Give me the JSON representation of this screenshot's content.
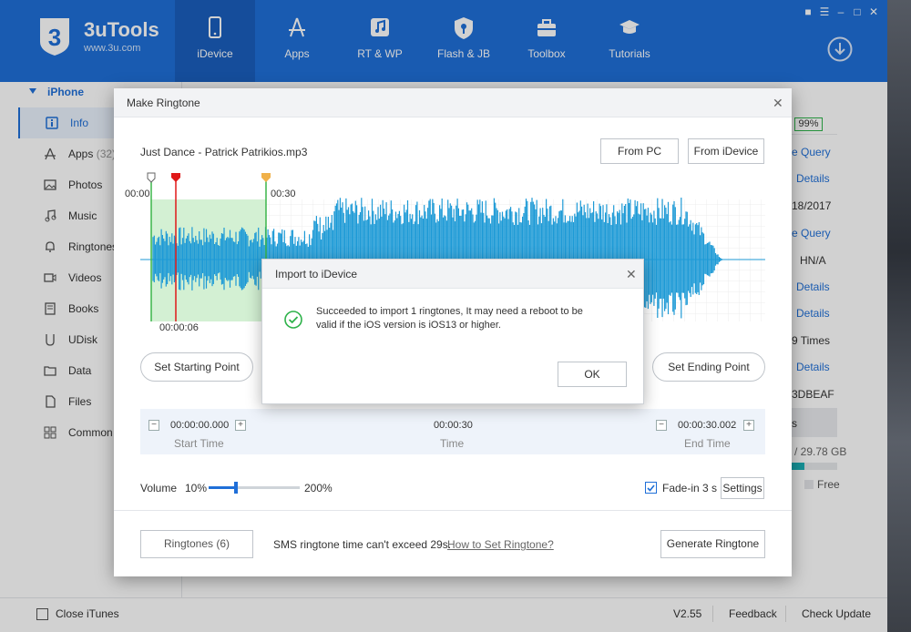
{
  "app": {
    "brand": "3uTools",
    "url": "www.3u.com",
    "nav": [
      {
        "label": "iDevice",
        "icon": "phone-icon",
        "active": true
      },
      {
        "label": "Apps",
        "icon": "appstore-icon"
      },
      {
        "label": "RT & WP",
        "icon": "music-note-icon"
      },
      {
        "label": "Flash & JB",
        "icon": "shield-key-icon"
      },
      {
        "label": "Toolbox",
        "icon": "toolbox-icon"
      },
      {
        "label": "Tutorials",
        "icon": "graduation-cap-icon"
      }
    ]
  },
  "sidebar": {
    "header": "iPhone",
    "items": [
      {
        "label": "Info",
        "icon": "info-icon"
      },
      {
        "label": "Apps",
        "count": "(32)",
        "icon": "appstore-icon"
      },
      {
        "label": "Photos",
        "icon": "photo-icon"
      },
      {
        "label": "Music",
        "icon": "music-icon"
      },
      {
        "label": "Ringtones",
        "icon": "bell-icon"
      },
      {
        "label": "Videos",
        "icon": "video-icon"
      },
      {
        "label": "Books",
        "icon": "book-icon"
      },
      {
        "label": "UDisk",
        "icon": "udisk-icon"
      },
      {
        "label": "Data",
        "icon": "folder-icon"
      },
      {
        "label": "Files",
        "icon": "file-icon"
      },
      {
        "label": "Common",
        "icon": "grid-icon"
      }
    ]
  },
  "info_panel": {
    "battery": "99%",
    "row1": "e Query",
    "row2": "Details",
    "row3": "18/2017",
    "row4": "e Query",
    "row5": "HN/A",
    "row6": "Details",
    "row7": "Details",
    "row8": "9 Times",
    "row9": "Details",
    "row10": "3DBEAF",
    "row11": "s",
    "storage": "/ 29.78 GB",
    "free": "Free"
  },
  "footer": {
    "close_itunes": "Close iTunes",
    "version": "V2.55",
    "feedback": "Feedback",
    "check_update": "Check Update"
  },
  "ringtone_dialog": {
    "title": "Make Ringtone",
    "file_name": "Just Dance - Patrick Patrikios.mp3",
    "from_pc": "From PC",
    "from_idevice": "From iDevice",
    "time_00": "00:00",
    "time_30": "00:30",
    "cursor_time": "00:00:06",
    "set_start": "Set Starting Point",
    "set_end": "Set Ending Point",
    "start_time_value": "00:00:00.000",
    "start_time_label": "Start Time",
    "time_value": "00:00:30",
    "time_label": "Time",
    "end_time_value": "00:00:30.002",
    "end_time_label": "End Time",
    "volume_label": "Volume",
    "volume_min": "10%",
    "volume_max": "200%",
    "volume_level": 0.3,
    "fade_label": "Fade-in 3 s",
    "settings": "Settings",
    "ringtones_button": "Ringtones (6)",
    "sms_note": "SMS ringtone time can't exceed 29s.",
    "how_to_link": "How to Set Ringtone?",
    "generate": "Generate Ringtone"
  },
  "import_popup": {
    "title": "Import to iDevice",
    "message_line1": "Succeeded to import 1 ringtones, It may need a reboot to be",
    "message_line2": "valid if the iOS version is iOS13 or higher.",
    "ok": "OK"
  },
  "colors": {
    "brand_blue": "#1f6fd8",
    "wave_blue": "#1d9ad6",
    "selection_green": "#cdeecd",
    "success_green": "#2eb24a"
  }
}
